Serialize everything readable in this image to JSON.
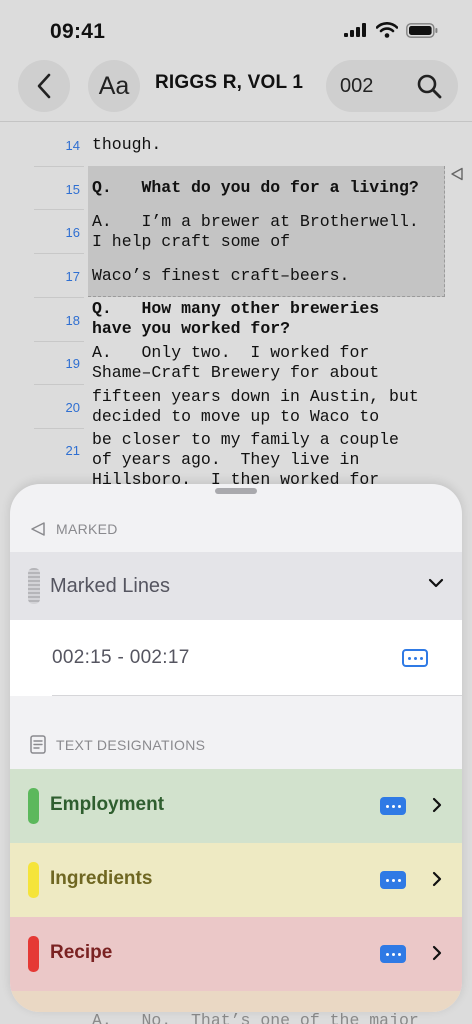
{
  "status": {
    "time": "09:41"
  },
  "nav": {
    "font_label": "Aa",
    "title": "RIGGS R, VOL 1",
    "page": "002"
  },
  "transcript": {
    "lines": [
      {
        "num": "14",
        "text": "though.",
        "bold": false
      },
      {
        "num": "15",
        "text": "Q.   What do you do for a living?",
        "bold": true
      },
      {
        "num": "16",
        "text": "A.   I’m a brewer at Brotherwell.\nI help craft some of",
        "bold": false
      },
      {
        "num": "17",
        "text": "Waco’s finest craft–beers.",
        "bold": false
      },
      {
        "num": "18",
        "text": "Q.   How many other breweries\nhave you worked for?",
        "bold": true
      },
      {
        "num": "19",
        "text": "A.   Only two.  I worked for\nShame–Craft Brewery for about",
        "bold": false
      },
      {
        "num": "20",
        "text": "fifteen years down in Austin, but\ndecided to move up to Waco to",
        "bold": false
      },
      {
        "num": "21",
        "text": "be closer to my family a couple\nof years ago.  They live in\nHillsboro.  I then worked for",
        "bold": false
      },
      {
        "num": "",
        "text": "A.   No.  That’s one of the major",
        "bold": false
      }
    ]
  },
  "sheet": {
    "marked_header": "MARKED",
    "marked_lines_label": "Marked Lines",
    "marked_range": "002:15 - 002:17",
    "text_designations_header": "TEXT DESIGNATIONS",
    "designations": [
      {
        "label": "Employment",
        "color": "#5cb85c",
        "bg": "#d2e2cd",
        "text_color": "#2f5e2f"
      },
      {
        "label": "Ingredients",
        "color": "#f5e43a",
        "bg": "#eeeac3",
        "text_color": "#6f6722"
      },
      {
        "label": "Recipe",
        "color": "#e53935",
        "bg": "#ebc8c8",
        "text_color": "#7a2222"
      }
    ]
  }
}
